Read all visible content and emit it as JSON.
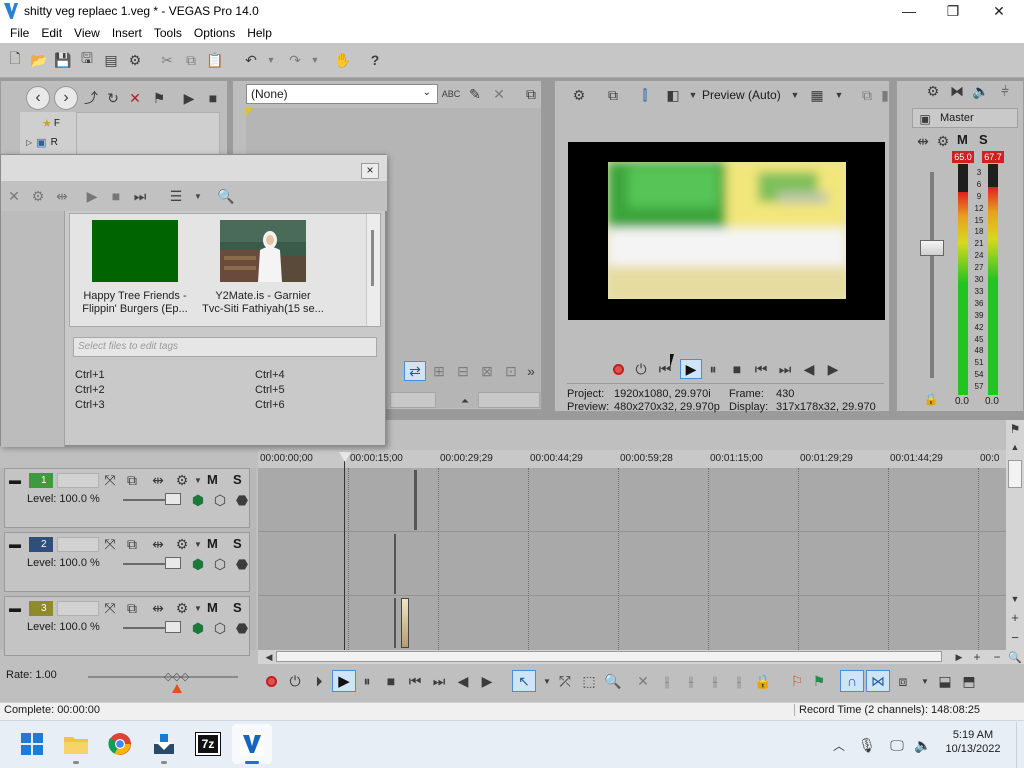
{
  "window": {
    "title": "shitty veg replaec 1.veg * - VEGAS Pro 14.0",
    "minimize": "—",
    "maximize": "❐",
    "close": "✕"
  },
  "menu": [
    "File",
    "Edit",
    "View",
    "Insert",
    "Tools",
    "Options",
    "Help"
  ],
  "explorer": {
    "tree_items": [
      "F",
      "R"
    ]
  },
  "trimmer": {
    "preset_value": "(None)"
  },
  "preview": {
    "quality_label": "Preview (Auto)",
    "project_label": "Project:",
    "project_value": "1920x1080, 29.970i",
    "preview_label": "Preview:",
    "preview_value": "480x270x32, 29.970p",
    "frame_label": "Frame:",
    "frame_value": "430",
    "display_label": "Display:",
    "display_value": "317x178x32, 29.970"
  },
  "master": {
    "label": "Master",
    "mute": "M",
    "solo": "S",
    "peak_left": "65.0",
    "peak_right": "67.7",
    "scale": [
      "3",
      "6",
      "9",
      "12",
      "15",
      "18",
      "21",
      "24",
      "27",
      "30",
      "33",
      "36",
      "39",
      "42",
      "45",
      "48",
      "51",
      "54",
      "57"
    ],
    "readout_left": "0.0",
    "readout_right": "0.0",
    "level_left": 0.88,
    "level_right": 0.9
  },
  "media": {
    "clips": [
      {
        "caption_line1": "Happy Tree Friends -",
        "caption_line2": "Flippin' Burgers (Ep..."
      },
      {
        "caption_line1": "Y2Mate.is - Garnier",
        "caption_line2": "Tvc-Siti Fathiyah(15 se..."
      }
    ],
    "tags_placeholder": "Select files to edit tags",
    "shortcuts_left": [
      "Ctrl+1",
      "Ctrl+2",
      "Ctrl+3"
    ],
    "shortcuts_right": [
      "Ctrl+4",
      "Ctrl+5",
      "Ctrl+6"
    ],
    "close": "×"
  },
  "timeline": {
    "ruler": [
      "00:00:00;00",
      "00:00:15;00",
      "00:00:29;29",
      "00:00:44;29",
      "00:00:59;28",
      "00:01:15;00",
      "00:01:29;29",
      "00:01:44;29",
      "00:0"
    ],
    "tracks": [
      {
        "number": "1",
        "level": "Level: 100.0 %",
        "color": "#3f9a3f",
        "mute": "M",
        "solo": "S"
      },
      {
        "number": "2",
        "level": "Level: 100.0 %",
        "color": "#2f4f7a",
        "mute": "M",
        "solo": "S"
      },
      {
        "number": "3",
        "level": "Level: 100.0 %",
        "color": "#8f8a2a",
        "mute": "M",
        "solo": "S"
      }
    ],
    "rate": "Rate: 1.00"
  },
  "status": {
    "left": "Complete: 00:00:00",
    "right": "Record Time (2 channels): 148:08:25"
  },
  "taskbar": {
    "time": "5:19 AM",
    "date": "10/13/2022",
    "apps": [
      "start-icon",
      "file-explorer-icon",
      "chrome-icon",
      "installer-icon",
      "7zip-icon",
      "vegas-icon"
    ],
    "sevenzip_label": "7z"
  },
  "colors": {
    "accent": "#2a7fd6",
    "highlight": "#cfe4f7",
    "meter_green": "#21c421",
    "meter_red": "#e02020"
  }
}
